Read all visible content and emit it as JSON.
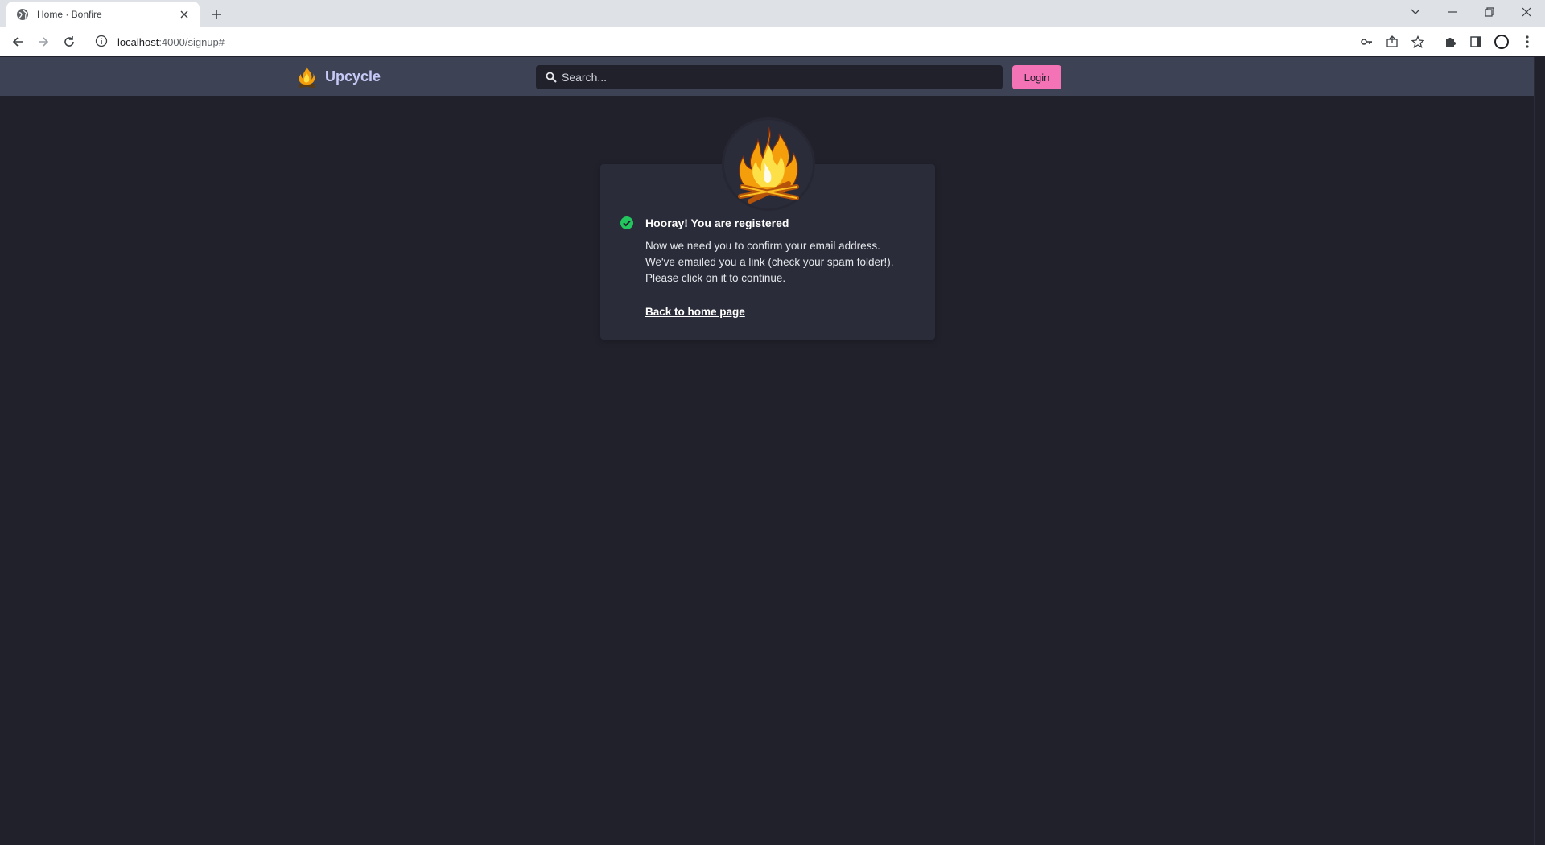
{
  "browser": {
    "tab_title": "Home · Bonfire",
    "url_host": "localhost",
    "url_rest": ":4000/signup#",
    "icons": [
      "globe-icon",
      "close-icon",
      "plus-icon",
      "chevron-down-icon",
      "minimize-icon",
      "restore-icon",
      "window-close-icon",
      "back-icon",
      "forward-icon",
      "reload-icon",
      "info-icon",
      "key-icon",
      "share-icon",
      "star-icon",
      "puzzle-icon",
      "sidepanel-icon",
      "profile-icon",
      "kebab-menu-icon"
    ]
  },
  "navbar": {
    "brand_name": "Upcycle",
    "search_placeholder": "Search...",
    "login_label": "Login",
    "accent_color": "#f472b6"
  },
  "notice": {
    "heading": "Hooray! You are registered",
    "body_lines": [
      "Now we need you to confirm your email address.",
      "We've emailed you a link (check your spam folder!).",
      "Please click on it to continue."
    ],
    "link_label": "Back to home page",
    "success_color": "#22c55e"
  }
}
